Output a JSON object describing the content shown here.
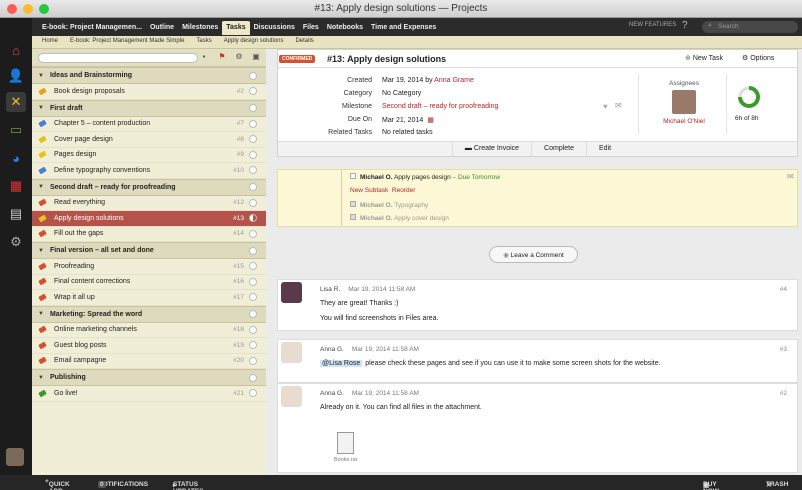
{
  "window": {
    "title": "#13: Apply design solutions — Projects"
  },
  "nav": {
    "tabs": [
      "E-book: Project Managemen...",
      "Outline",
      "Milestones",
      "Tasks",
      "Discussions",
      "Files",
      "Notebooks",
      "Time and Expenses"
    ],
    "active": "Tasks",
    "new_features": "NEW FEATURES",
    "help": "?",
    "search_placeholder": "Search"
  },
  "breadcrumb": [
    "Home",
    "E-book: Project Management Made Simple",
    "Tasks",
    "Apply design solutions",
    "Details"
  ],
  "task_groups": [
    {
      "name": "Ideas and Brainstorming",
      "tasks": [
        {
          "title": "Book design proposals",
          "num": "#2",
          "tag": "#e7a21c"
        }
      ]
    },
    {
      "name": "First draft",
      "tasks": [
        {
          "title": "Chapter 5 – content production",
          "num": "#7",
          "tag": "#4a7fd4"
        },
        {
          "title": "Cover page design",
          "num": "#8",
          "tag": "#e7c21c"
        },
        {
          "title": "Pages design",
          "num": "#9",
          "tag": "#e7c21c"
        },
        {
          "title": "Define typography conventions",
          "num": "#10",
          "tag": "#4a7fd4"
        }
      ]
    },
    {
      "name": "Second draft – ready for proofreading",
      "tasks": [
        {
          "title": "Read everything",
          "num": "#12",
          "tag": "#d9502d"
        },
        {
          "title": "Apply design solutions",
          "num": "#13",
          "tag": "#e7c21c",
          "selected": true
        },
        {
          "title": "Fill out the gaps",
          "num": "#14",
          "tag": "#d9502d"
        }
      ]
    },
    {
      "name": "Final version – all set and done",
      "tasks": [
        {
          "title": "Proofreading",
          "num": "#15",
          "tag": "#d9502d"
        },
        {
          "title": "Final content corrections",
          "num": "#16",
          "tag": "#d9502d"
        },
        {
          "title": "Wrap it all up",
          "num": "#17",
          "tag": "#d9502d"
        }
      ]
    },
    {
      "name": "Marketing: Spread the word",
      "tasks": [
        {
          "title": "Online marketing channels",
          "num": "#18",
          "tag": "#d9502d"
        },
        {
          "title": "Guest blog posts",
          "num": "#19",
          "tag": "#d9502d"
        },
        {
          "title": "Email campagne",
          "num": "#20",
          "tag": "#d9502d"
        }
      ]
    },
    {
      "name": "Publishing",
      "tasks": [
        {
          "title": "Go live!",
          "num": "#21",
          "tag": "#3a9a2a"
        }
      ]
    }
  ],
  "task": {
    "badge": "CONFIRMED",
    "title": "#13: Apply design solutions",
    "new_task": "New Task",
    "options": "Options",
    "details": [
      {
        "label": "Created",
        "value": "Mar 19, 2014 by ",
        "link": "Anna Grame"
      },
      {
        "label": "Category",
        "value": "No Category",
        "link": ""
      },
      {
        "label": "Milestone",
        "value": "",
        "link": "Second draft – ready for proofreading"
      },
      {
        "label": "Due On",
        "value": "Mar 21, 2014",
        "link": ""
      },
      {
        "label": "Related Tasks",
        "value": "No related tasks",
        "link": ""
      }
    ],
    "assignees_label": "Assignees",
    "assignee": "Michael O'Niel",
    "progress": "6h of 8h",
    "progress_fraction": 0.75,
    "actions": [
      "Create Invoice",
      "Complete",
      "Edit"
    ]
  },
  "subtasks": {
    "first": {
      "who": "Michael O.",
      "text": "Apply pages design",
      "due": "– Due Tomorrow"
    },
    "new_subtask": "New Subtask",
    "reorder": "Reorder",
    "done": [
      {
        "who": "Michael O.",
        "text": "Typography"
      },
      {
        "who": "Michael O.",
        "text": "Apply cover design"
      }
    ]
  },
  "leave_comment": "Leave a Comment",
  "comments": [
    {
      "author": "Lisa R.",
      "date": "Mar 19, 2014 11:58 AM",
      "num": "#4",
      "lines": [
        "They are great! Thanks :)",
        "You will find screenshots in Files area."
      ]
    },
    {
      "author": "Anna G.",
      "date": "Mar 19, 2014 11:58 AM",
      "num": "#3",
      "mention": "@Lisa Rose",
      "lines": [
        "please check these pages and see if you can use it to make some screen shots for the website."
      ]
    },
    {
      "author": "Anna G.",
      "date": "Mar 19, 2014 11:58 AM",
      "num": "#2",
      "lines": [
        "Already on it. You can find all files in the attachment."
      ],
      "attachment": "Books.rar"
    }
  ],
  "bottom": {
    "quick_add": "QUICK ADD",
    "notifications": "NOTIFICATIONS",
    "notif_count": "0",
    "status": "STATUS UPDATES",
    "buy": "BUY NOW",
    "trash": "TRASH"
  }
}
